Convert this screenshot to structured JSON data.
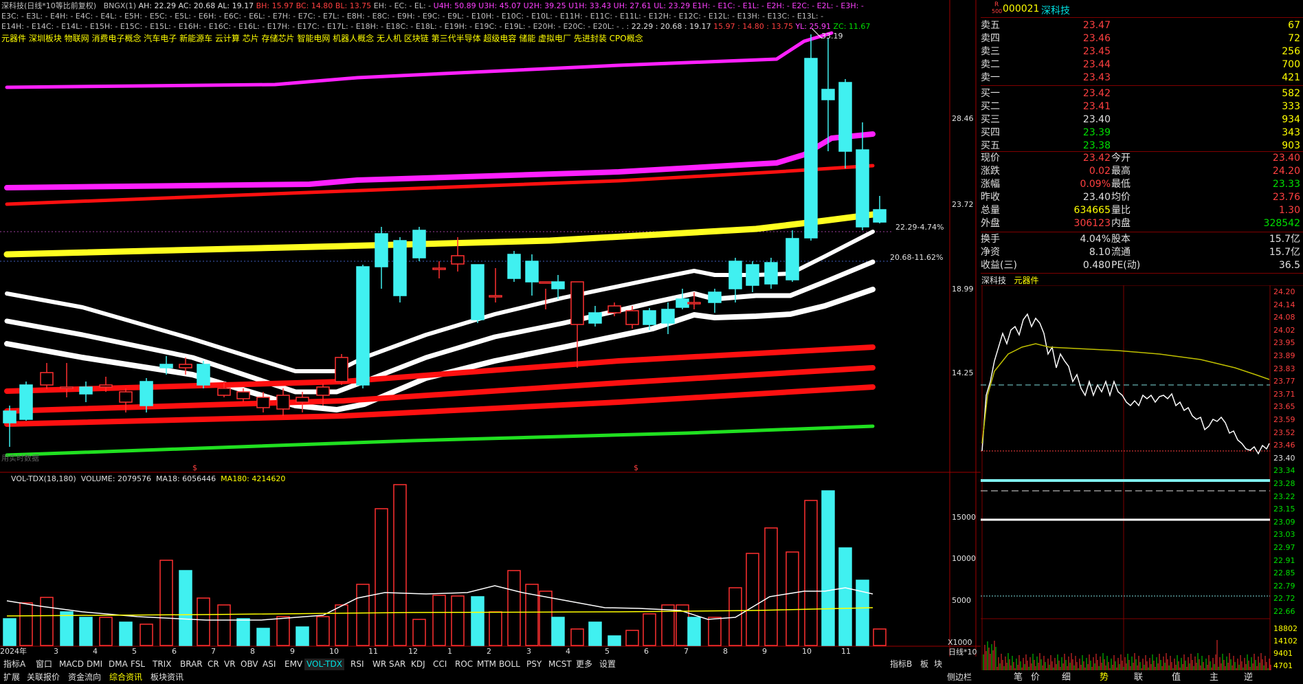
{
  "header": {
    "title_line": "深科技(日线*10等比前复权)",
    "indicator": "BNGX(1)",
    "values": [
      {
        "k": "AH:",
        "v": "22.29"
      },
      {
        "k": "AC:",
        "v": "20.68"
      },
      {
        "k": "AL:",
        "v": "19.17"
      },
      {
        "k": "BH:",
        "v": "15.97"
      },
      {
        "k": "BC:",
        "v": "14.80"
      },
      {
        "k": "BL:",
        "v": "13.75"
      }
    ],
    "line1_tail": "EH: - EC: - EL: -",
    "u_values": "U4H: 50.89  U3H: 45.07  U2H: 39.25  U1H: 33.43  UH: 27.61  UL: 23.29  E1H: -  E1C: -  E1L: -  E2H: -  E2C: -  E2L: -  E3H: -",
    "line2": "E3C: -  E3L: -  E4H: -  E4C: -  E4L: -  E5H: -  E5C: -  E5L: -  E6H: -  E6C: -  E6L: -  E7H: -  E7C: -  E7L: -  E8H: -  E8C: -  E9H: -  E9C: -  E9L: -  E10H: -  E10C: -  E10L: -  E11H: -  E11C: -  E11L: -  E12H: -  E12C: -  E12L: -  E13H: -  E13C: -  E13L: -",
    "line3a": "E14H: -  E14C: -  E14L: -  E15H: -  E15C: -  E15L: -  E16H: -  E16C: -  E16L: -  E17H: -  E17C: -  E17L: -  E18H: -  E18C: -  E18L: -  E19H: -  E19C: -  E19L: -  E20H: -  E20C: -  E20L: -  . :",
    "line3b": "22.29  :  20.68  :  19.17",
    "line3c": "15.97  :  14.80  :  13.75",
    "line3d": "YL: 25.91",
    "line3e": "ZC: 11.67",
    "concepts": "元器件  深圳板块  物联网  消费电子概念  汽车电子  新能源车  云计算  芯片  存储芯片  智能电网  机器人概念  无人机  区块链  第三代半导体  超级电容  储能  虚拟电厂  先进封装  CPO概念"
  },
  "price_axis": [
    "28.46",
    "23.72",
    "18.99",
    "14.25"
  ],
  "price_labels": [
    {
      "text": "33.19"
    },
    {
      "text": "22.29-4.74%"
    },
    {
      "text": "20.68-11.62%"
    },
    {
      "text": "$"
    },
    {
      "text": "$"
    }
  ],
  "watermark": "用实时数据",
  "volume": {
    "title": "VOL-TDX(18,180)",
    "vol_label": "VOLUME: 2079576",
    "ma18_label": "MA18: 6056446",
    "ma180_label": "MA180: 4214620",
    "axis": [
      "15000",
      "10000",
      "5000"
    ],
    "unit": "X1000"
  },
  "months": [
    "2024年",
    "3",
    "4",
    "5",
    "6",
    "7",
    "8",
    "9",
    "10",
    "11",
    "12",
    "1",
    "2",
    "3",
    "4",
    "5",
    "6",
    "7",
    "8",
    "9",
    "10",
    "11"
  ],
  "tabs_row1": [
    "指标A",
    "窗口",
    "MACD",
    "DMI",
    "DMA",
    "FSL",
    "TRIX",
    "BRAR",
    "CR",
    "VR",
    "OBV",
    "ASI",
    "EMV",
    "VOL-TDX",
    "RSI",
    "WR",
    "SAR",
    "KDJ",
    "CCI",
    "ROC",
    "MTM",
    "BOLL",
    "PSY",
    "MCST",
    "更多",
    "设置"
  ],
  "tabs_row1_active": "VOL-TDX",
  "tabs_row1_right": [
    "指标B",
    "板",
    "块"
  ],
  "tabs_row2": [
    "扩展",
    "关联报价",
    "资金流向",
    "综合资讯",
    "板块资讯"
  ],
  "tabs_row2_active": "综合资讯",
  "stock": {
    "code": "000021",
    "name": "深科技",
    "r_label": "R",
    "r_sub": "500"
  },
  "asks": [
    {
      "label": "卖五",
      "price": "23.47",
      "vol": "67"
    },
    {
      "label": "卖四",
      "price": "23.46",
      "vol": "72"
    },
    {
      "label": "卖三",
      "price": "23.45",
      "vol": "256"
    },
    {
      "label": "卖二",
      "price": "23.44",
      "vol": "700"
    },
    {
      "label": "卖一",
      "price": "23.43",
      "vol": "421"
    }
  ],
  "bids": [
    {
      "label": "买一",
      "price": "23.42",
      "vol": "582"
    },
    {
      "label": "买二",
      "price": "23.41",
      "vol": "333"
    },
    {
      "label": "买三",
      "price": "23.40",
      "vol": "934"
    },
    {
      "label": "买四",
      "price": "23.39",
      "vol": "343"
    },
    {
      "label": "买五",
      "price": "23.38",
      "vol": "903"
    }
  ],
  "quote": [
    {
      "k1": "现价",
      "v1": "23.42",
      "k2": "今开",
      "v2": "23.40"
    },
    {
      "k1": "涨跌",
      "v1": "0.02",
      "k2": "最高",
      "v2": "24.20"
    },
    {
      "k1": "涨幅",
      "v1": "0.09%",
      "k2": "最低",
      "v2": "23.33"
    },
    {
      "k1": "昨收",
      "v1": "23.40",
      "k2": "均价",
      "v2": "23.76"
    },
    {
      "k1": "总量",
      "v1": "634665",
      "k2": "量比",
      "v2": "1.30"
    },
    {
      "k1": "外盘",
      "v1": "306123",
      "k2": "内盘",
      "v2": "328542"
    }
  ],
  "stats": [
    {
      "k1": "换手",
      "v1": "4.04%",
      "k2": "股本",
      "v2": "15.7亿"
    },
    {
      "k1": "净资",
      "v1": "8.10",
      "k2": "流通",
      "v2": "15.7亿"
    },
    {
      "k1": "收益(三)",
      "v1": "0.480",
      "k2": "PE(动)",
      "v2": "36.5"
    }
  ],
  "intraday": {
    "title_name": "深科技",
    "title_sector": "元器件",
    "axis": [
      "24.20",
      "24.14",
      "24.08",
      "24.02",
      "23.95",
      "23.89",
      "23.83",
      "23.77",
      "23.71",
      "23.65",
      "23.59",
      "23.52",
      "23.46",
      "23.40",
      "23.34",
      "23.28",
      "23.22",
      "23.15",
      "23.09",
      "23.03",
      "22.97",
      "22.91",
      "22.85",
      "22.79",
      "22.72",
      "22.66"
    ],
    "vol_axis": [
      "18802",
      "14102",
      "9401",
      "4701"
    ],
    "range_label": "日线*10"
  },
  "right_tabs": [
    "笔",
    "价",
    "细",
    "势",
    "联",
    "值",
    "主",
    "逆"
  ],
  "right_tabs_active": "势",
  "side_label": "侧边栏"
}
